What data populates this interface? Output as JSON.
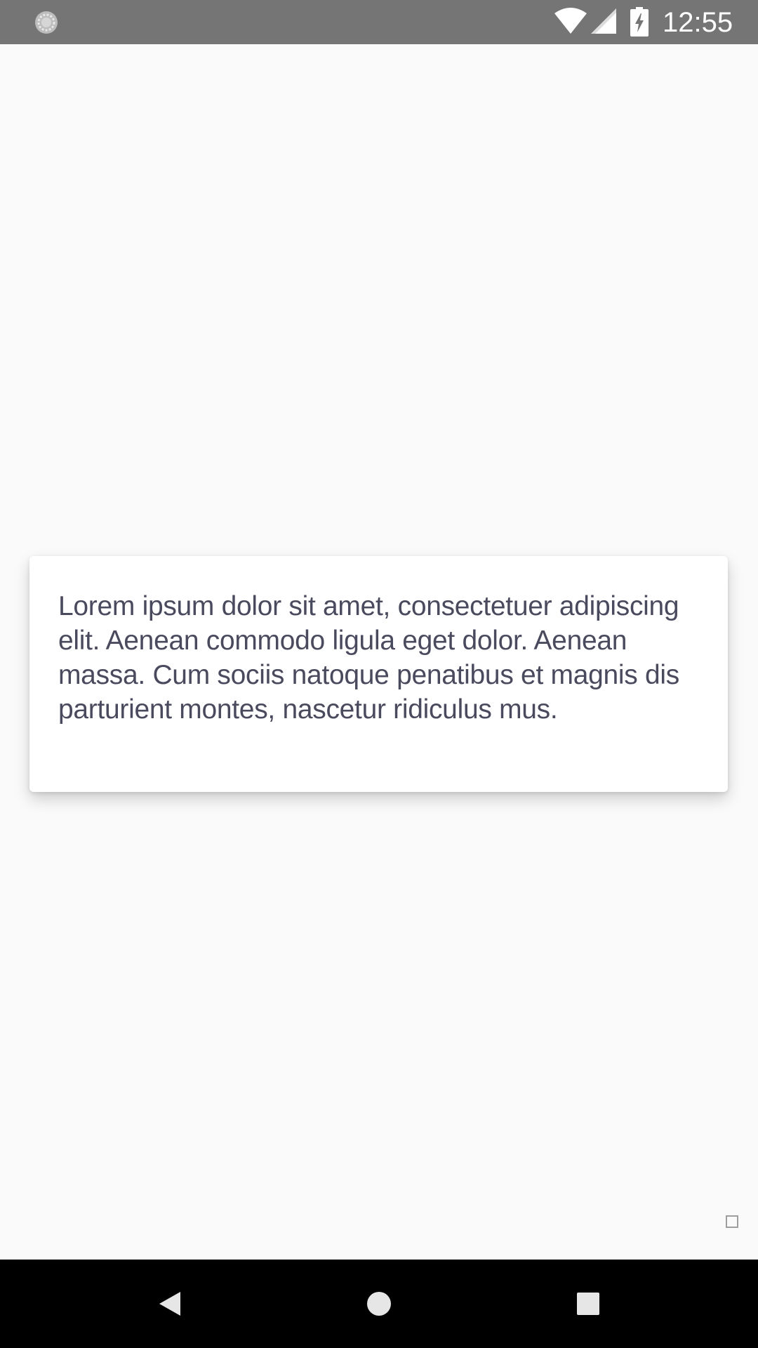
{
  "status_bar": {
    "time": "12:55",
    "left_icon": "sync-circle-icon",
    "wifi_icon": "wifi-icon",
    "cell_icon": "cell-signal-icon",
    "battery_icon": "battery-charging-icon"
  },
  "card": {
    "text": "Lorem ipsum dolor sit amet, consectetuer adipiscing elit. Aenean commodo ligula eget dolor. Aenean massa. Cum sociis natoque penatibus et magnis dis parturient montes, nascetur ridiculus mus."
  },
  "nav_bar": {
    "back_icon": "back-triangle-icon",
    "home_icon": "home-circle-icon",
    "recents_icon": "recents-square-icon"
  },
  "colors": {
    "status_bar_bg": "#757575",
    "page_bg": "#fafafa",
    "card_bg": "#ffffff",
    "text": "#4a4a5e",
    "nav_bar_bg": "#000000"
  }
}
